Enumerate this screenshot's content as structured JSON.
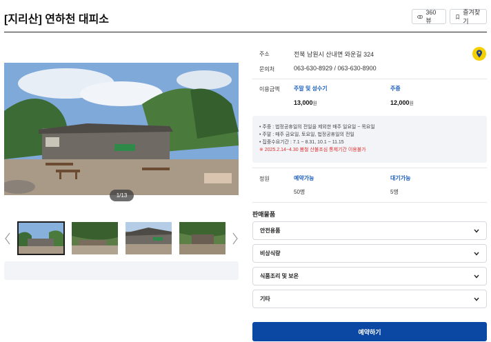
{
  "header": {
    "title": "[지리산] 연하천 대피소",
    "view360_label": "360뷰",
    "bookmark_label": "즐겨찾기"
  },
  "gallery": {
    "counter": "1/13",
    "thumbnail_count": 4
  },
  "info": {
    "address_label": "주소",
    "address_value": "전북 남원시 산내면 와운길 324",
    "contact_label": "문의처",
    "contact_value": "063-630-8929 / 063-630-8900",
    "fee_label": "이용금액",
    "weekend_head": "주말 및 성수기",
    "weekend_price": "13,000",
    "weekday_head": "주중",
    "weekday_price": "12,000",
    "currency": "원"
  },
  "notice": {
    "lines": [
      "• 주중 : 법정공휴일의 전일을 제외한 매주 일요일 ~ 목요일",
      "• 주말 : 매주 금요일, 토요일, 법정공휴일의 전일",
      "• 집중수요기간 : 7.1 ~ 8.31, 10.1 ~ 11.15"
    ],
    "warning": "※ 2025.2.14~4.30 봄철 산불조심 통제기간 이용불가"
  },
  "capacity": {
    "label": "정원",
    "reservable_head": "예약가능",
    "reservable_value": "50명",
    "waiting_head": "대기가능",
    "waiting_value": "5명"
  },
  "products": {
    "section_label": "판매물품",
    "items": [
      "안전용품",
      "비상식량",
      "식품조리 및 보온",
      "기타"
    ]
  },
  "reserve_label": "예약하기",
  "colors": {
    "primary": "#0a48a3",
    "accent_blue": "#1a5fbf",
    "warning_red": "#e03030",
    "location_yellow": "#f5d000"
  }
}
